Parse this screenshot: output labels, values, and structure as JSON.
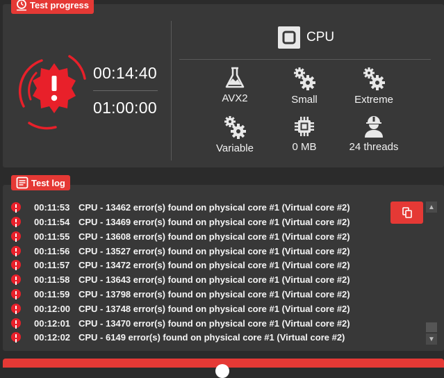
{
  "progress": {
    "tag": "Test progress",
    "elapsed": "00:14:40",
    "total": "01:00:00"
  },
  "cpu": {
    "title": "CPU",
    "stats": [
      {
        "icon": "flask-icon",
        "label": "AVX2"
      },
      {
        "icon": "gears-icon",
        "label": "Small"
      },
      {
        "icon": "gears-icon",
        "label": "Extreme"
      },
      {
        "icon": "gears-icon",
        "label": "Variable"
      },
      {
        "icon": "chip-icon",
        "label": "0 MB"
      },
      {
        "icon": "worker-icon",
        "label": "24 threads"
      }
    ]
  },
  "log": {
    "tag": "Test log",
    "entries": [
      {
        "time": "00:11:53",
        "text": "CPU - 13462 error(s) found on physical core #1 (Virtual core #2)"
      },
      {
        "time": "00:11:54",
        "text": "CPU - 13469 error(s) found on physical core #1 (Virtual core #2)"
      },
      {
        "time": "00:11:55",
        "text": "CPU - 13608 error(s) found on physical core #1 (Virtual core #2)"
      },
      {
        "time": "00:11:56",
        "text": "CPU - 13527 error(s) found on physical core #1 (Virtual core #2)"
      },
      {
        "time": "00:11:57",
        "text": "CPU - 13472 error(s) found on physical core #1 (Virtual core #2)"
      },
      {
        "time": "00:11:58",
        "text": "CPU - 13643 error(s) found on physical core #1 (Virtual core #2)"
      },
      {
        "time": "00:11:59",
        "text": "CPU - 13798 error(s) found on physical core #1 (Virtual core #2)"
      },
      {
        "time": "00:12:00",
        "text": "CPU - 13748 error(s) found on physical core #1 (Virtual core #2)"
      },
      {
        "time": "00:12:01",
        "text": "CPU - 13470 error(s) found on physical core #1 (Virtual core #2)"
      },
      {
        "time": "00:12:02",
        "text": "CPU - 6149 error(s) found on physical core #1 (Virtual core #2)"
      }
    ]
  },
  "colors": {
    "accent": "#e53935",
    "panel": "#383838",
    "background": "#2b2b2b"
  }
}
